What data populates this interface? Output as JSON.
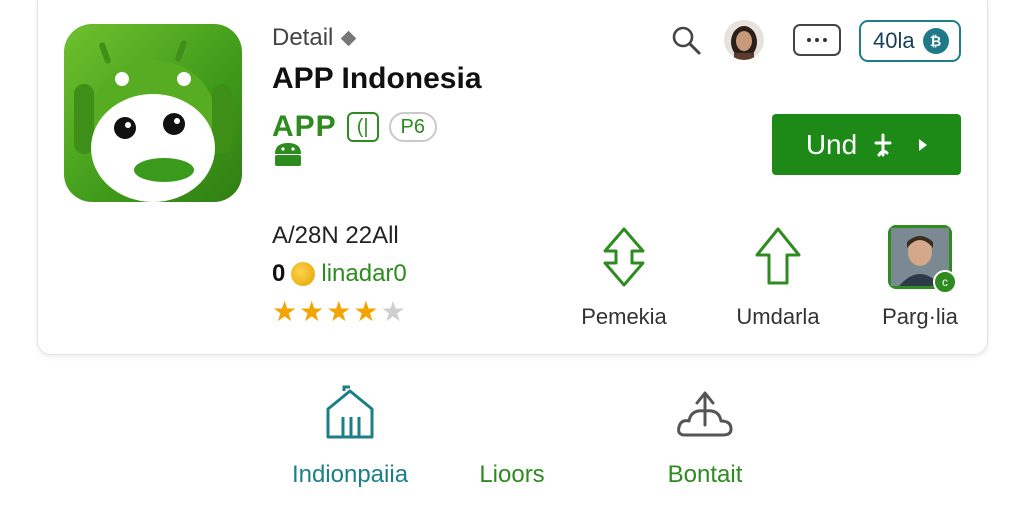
{
  "header": {
    "breadcrumb": "Detail",
    "app_title": "APP Indonesia",
    "brand_text": "APP",
    "brand_badge": "(|",
    "pill_badge": "P6",
    "count_badge": "40la",
    "count_dot": "₿"
  },
  "install": {
    "label": "Und"
  },
  "stats": {
    "line1": "A/28N 22All",
    "rating_count": "0",
    "rating_label": "linadar0",
    "rating_stars": 4,
    "rating_max": 5
  },
  "actions": [
    {
      "label": "Pemekia",
      "icon": "arrow-up-down-icon"
    },
    {
      "label": "Umdarla",
      "icon": "arrow-up-icon"
    },
    {
      "label": "Parg·lia",
      "icon": "person-thumbnail"
    }
  ],
  "bottom_nav": [
    {
      "label": "Indionpaiia",
      "icon": "home-icon",
      "color": "#1b7f86"
    },
    {
      "label": "Lioors",
      "icon": "",
      "color": "#2e8b1f"
    },
    {
      "label": "Bontait",
      "icon": "cloud-upload-icon",
      "color": "#2e8b1f"
    }
  ],
  "colors": {
    "accent_green": "#1d8a17",
    "teal": "#1f7f86",
    "star": "#f4a400"
  }
}
